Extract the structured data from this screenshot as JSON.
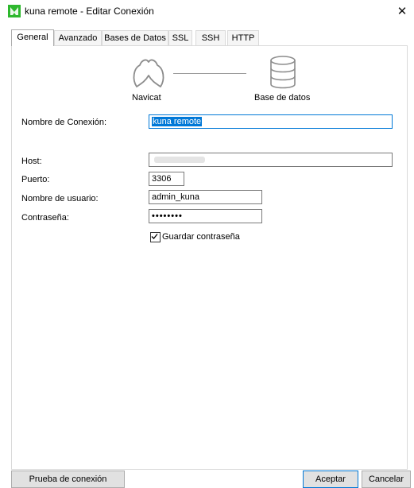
{
  "window": {
    "title": "kuna remote - Editar Conexión",
    "close_glyph": "✕"
  },
  "tabs": [
    {
      "label": "General",
      "active": true
    },
    {
      "label": "Avanzado",
      "active": false
    },
    {
      "label": "Bases de Datos",
      "active": false
    },
    {
      "label": "SSL",
      "active": false
    },
    {
      "label": "SSH",
      "active": false
    },
    {
      "label": "HTTP",
      "active": false
    }
  ],
  "diagram": {
    "left_label": "Navicat",
    "right_label": "Base de datos",
    "left_icon": "navicat-logo-icon",
    "right_icon": "database-icon"
  },
  "form": {
    "connection_name": {
      "label": "Nombre de Conexión:",
      "value": "kuna remote"
    },
    "host": {
      "label": "Host:",
      "value": ""
    },
    "port": {
      "label": "Puerto:",
      "value": "3306"
    },
    "username": {
      "label": "Nombre de usuario:",
      "value": "admin_kuna"
    },
    "password": {
      "label": "Contraseña:",
      "value": "••••••••"
    },
    "save_password": {
      "label": "Guardar contraseña",
      "checked": true
    }
  },
  "buttons": {
    "test": "Prueba de conexión",
    "ok": "Aceptar",
    "cancel": "Cancelar"
  },
  "colors": {
    "accent": "#0078d7",
    "app_icon": "#2eb82e"
  }
}
